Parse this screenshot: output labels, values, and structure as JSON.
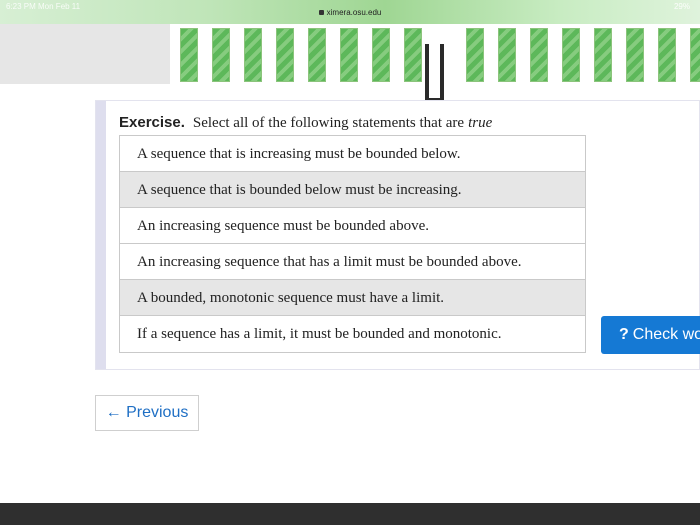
{
  "status_bar": {
    "time": "6:23 PM  Mon Feb 11",
    "url": "ximera.osu.edu",
    "battery": "29%"
  },
  "exercise": {
    "label": "Exercise.",
    "prompt": "Select all of the following statements that are",
    "emphasis": "true",
    "options": [
      {
        "text": "A sequence that is increasing must be bounded below.",
        "selected": false
      },
      {
        "text": "A sequence that is bounded below must be increasing.",
        "selected": true
      },
      {
        "text": "An increasing sequence must be bounded above.",
        "selected": false
      },
      {
        "text": "An increasing sequence that has a limit must be bounded above.",
        "selected": false
      },
      {
        "text": "A bounded, monotonic sequence must have a limit.",
        "selected": true
      },
      {
        "text": "If a sequence has a limit, it must be bounded and monotonic.",
        "selected": false
      }
    ]
  },
  "check_button": {
    "icon": "?",
    "label": "Check wo"
  },
  "nav": {
    "previous_label": "← Previous"
  },
  "colors": {
    "accent": "#1579d4",
    "link": "#1f6fc4",
    "green": "#5db85a",
    "footer": "#2f2f2f"
  }
}
